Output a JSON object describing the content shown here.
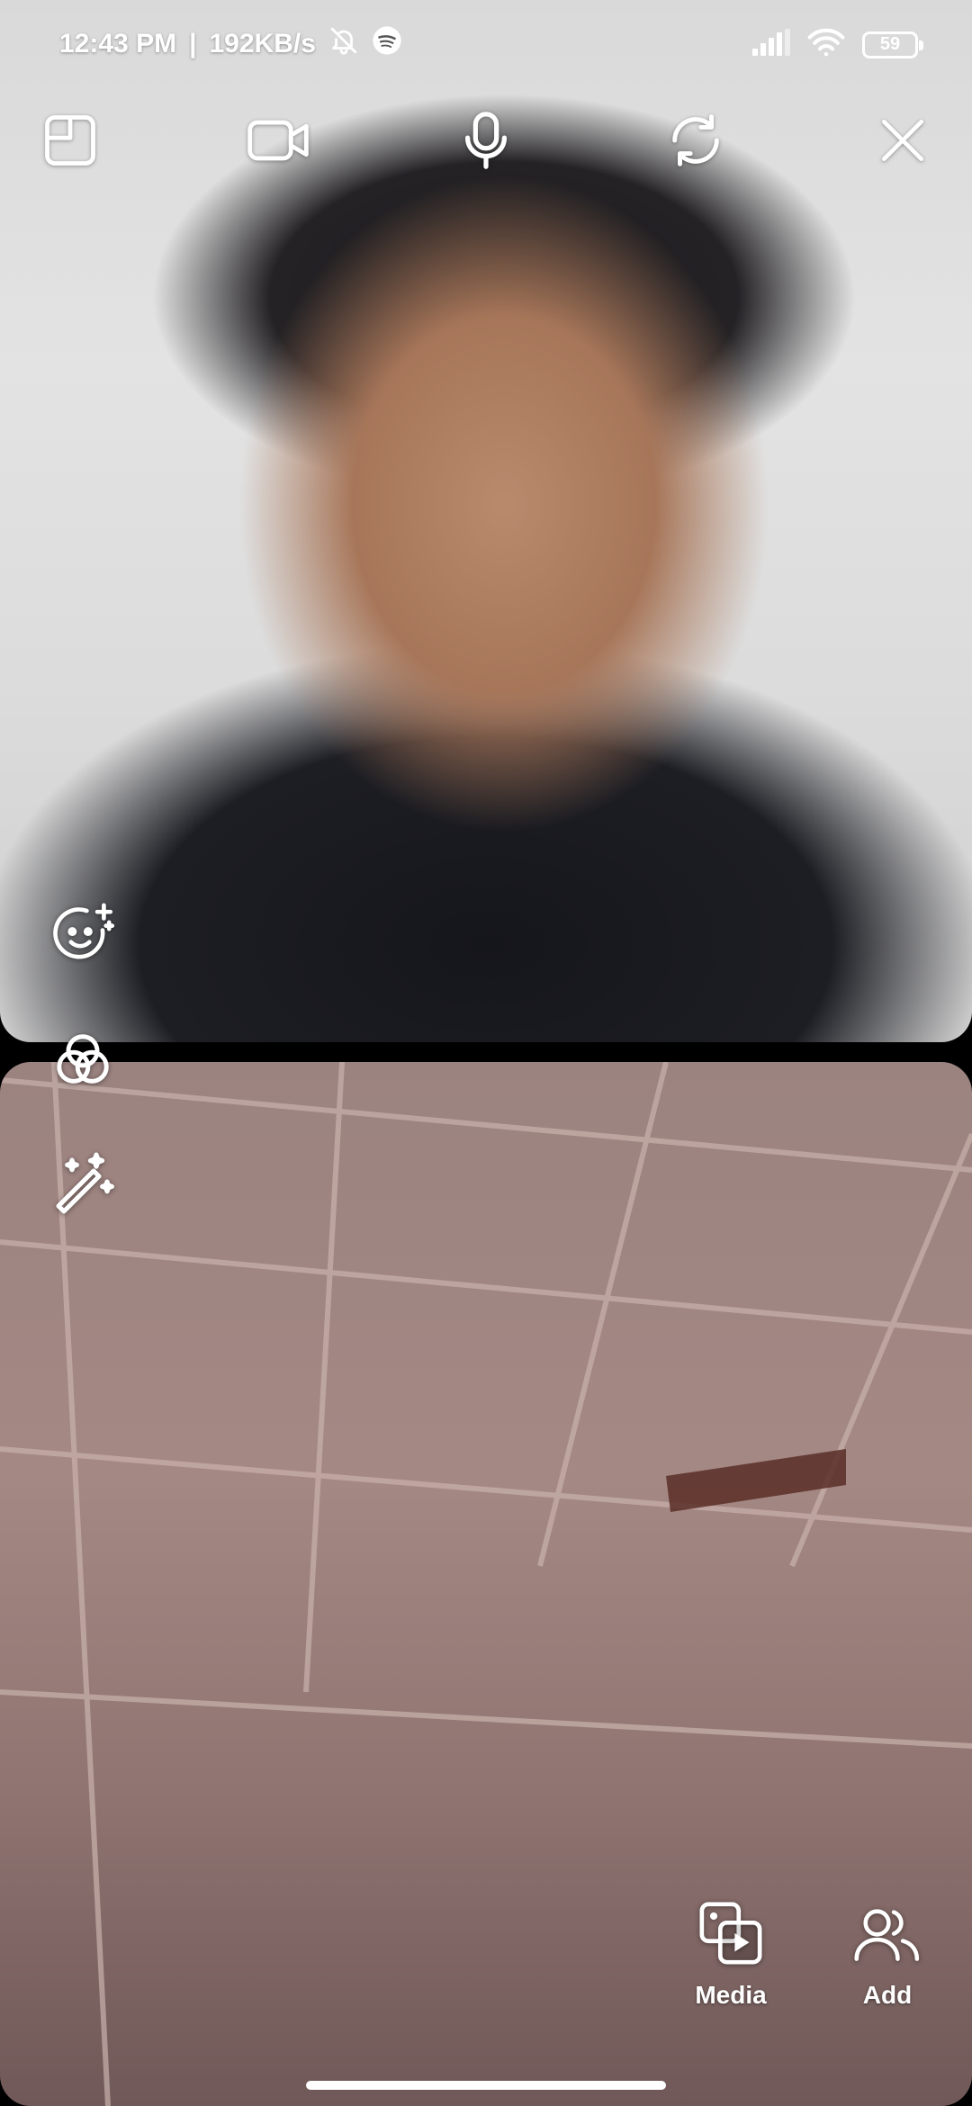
{
  "status_bar": {
    "time": "12:43 PM",
    "separator": "|",
    "network_speed": "192KB/s",
    "battery_level": "59",
    "icons": [
      "bell-off-icon",
      "spotify-icon",
      "signal-icon",
      "wifi-icon",
      "battery-icon"
    ]
  },
  "call_controls": {
    "items": [
      {
        "name": "layout-icon"
      },
      {
        "name": "video-camera-icon"
      },
      {
        "name": "microphone-icon"
      },
      {
        "name": "switch-camera-icon"
      },
      {
        "name": "close-icon"
      }
    ]
  },
  "effects_toolbar": {
    "items": [
      {
        "name": "face-effects-icon"
      },
      {
        "name": "filters-icon"
      },
      {
        "name": "magic-wand-icon"
      }
    ]
  },
  "bottom_actions": {
    "media_label": "Media",
    "add_label": "Add"
  },
  "colors": {
    "icon": "#ffffff",
    "background": "#000000"
  }
}
